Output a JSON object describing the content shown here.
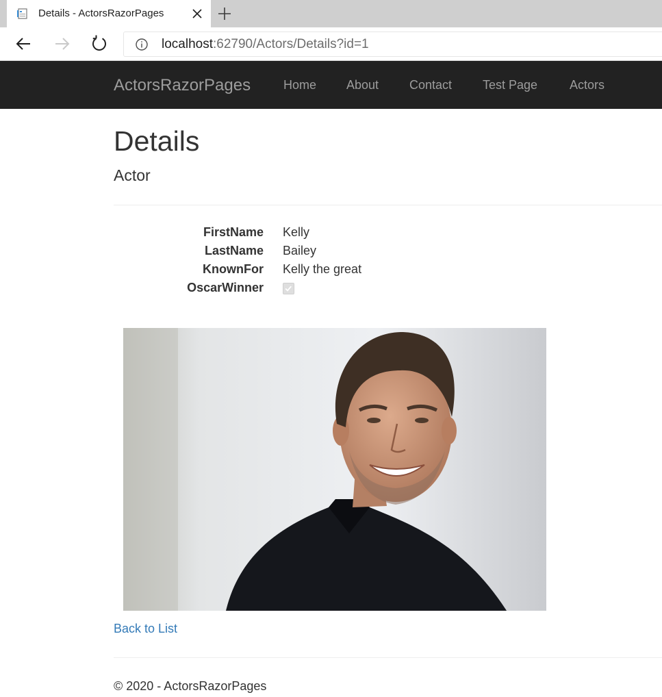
{
  "browser": {
    "tab_title": "Details - ActorsRazorPages",
    "url_host": "localhost",
    "url_rest": ":62790/Actors/Details?id=1"
  },
  "navbar": {
    "brand": "ActorsRazorPages",
    "links": [
      "Home",
      "About",
      "Contact",
      "Test Page",
      "Actors"
    ]
  },
  "page": {
    "title": "Details",
    "subtitle": "Actor",
    "fields": [
      {
        "label": "FirstName",
        "value": "Kelly"
      },
      {
        "label": "LastName",
        "value": "Bailey"
      },
      {
        "label": "KnownFor",
        "value": "Kelly the great"
      },
      {
        "label": "OscarWinner",
        "checked": true
      }
    ],
    "back_link": "Back to List",
    "footer": "© 2020 - ActorsRazorPages"
  },
  "colors": {
    "navbar_bg": "#222222",
    "nav_text": "#9d9d9d",
    "link": "#337ab7",
    "text": "#333333"
  },
  "icons": {
    "tab": "page-icon",
    "close": "close-icon",
    "new_tab": "plus-icon",
    "back": "arrow-left-icon",
    "forward": "arrow-right-icon",
    "reload": "reload-icon",
    "site_info": "info-icon",
    "checkbox": "checkbox-checked-icon"
  }
}
